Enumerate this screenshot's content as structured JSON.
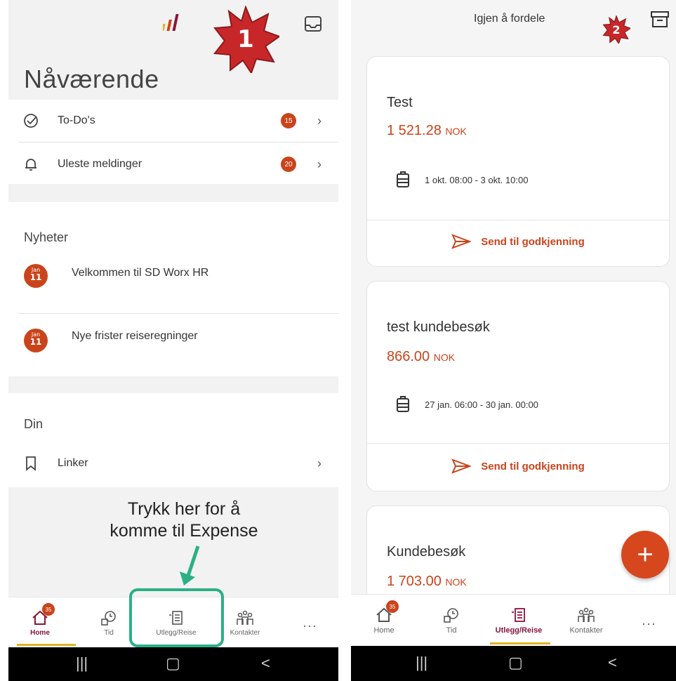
{
  "left": {
    "page_title": "Nåværende",
    "step_badge": "1",
    "rows": [
      {
        "label": "To-Do's",
        "count": "15"
      },
      {
        "label": "Uleste meldinger",
        "count": "20"
      }
    ],
    "news_title": "Nyheter",
    "news": [
      {
        "month": "Jan",
        "day": "11",
        "title": "Velkommen til SD Worx HR"
      },
      {
        "month": "Jan",
        "day": "11",
        "title": "Nye frister reiseregninger"
      }
    ],
    "din_title": "Din",
    "links_label": "Linker",
    "annotation_line1": "Trykk her for å",
    "annotation_line2": "komme til Expense",
    "nav": {
      "home": "Home",
      "home_badge": "35",
      "tid": "Tid",
      "utlegg": "Utlegg/Reise",
      "kontakter": "Kontakter",
      "more": "..."
    }
  },
  "right": {
    "title": "Igjen å fordele",
    "step_badge": "2",
    "cards": [
      {
        "name": "Test",
        "amount": "1 521.28",
        "currency": "NOK",
        "dates": "1 okt. 08:00 - 3 okt. 10:00",
        "action": "Send til godkjenning"
      },
      {
        "name": "test kundebesøk",
        "amount": "866.00",
        "currency": "NOK",
        "dates": "27 jan. 06:00 - 30 jan. 00:00",
        "action": "Send til godkjenning"
      },
      {
        "name": "Kundebesøk",
        "amount": "1 703.00",
        "currency": "NOK"
      }
    ],
    "nav": {
      "home": "Home",
      "home_badge": "35",
      "tid": "Tid",
      "utlegg": "Utlegg/Reise",
      "kontakter": "Kontakter",
      "more": "..."
    }
  },
  "colors": {
    "accent": "#c9441b",
    "active_nav": "#8a1538",
    "highlight": "#2bb086",
    "underline": "#e1b321"
  }
}
